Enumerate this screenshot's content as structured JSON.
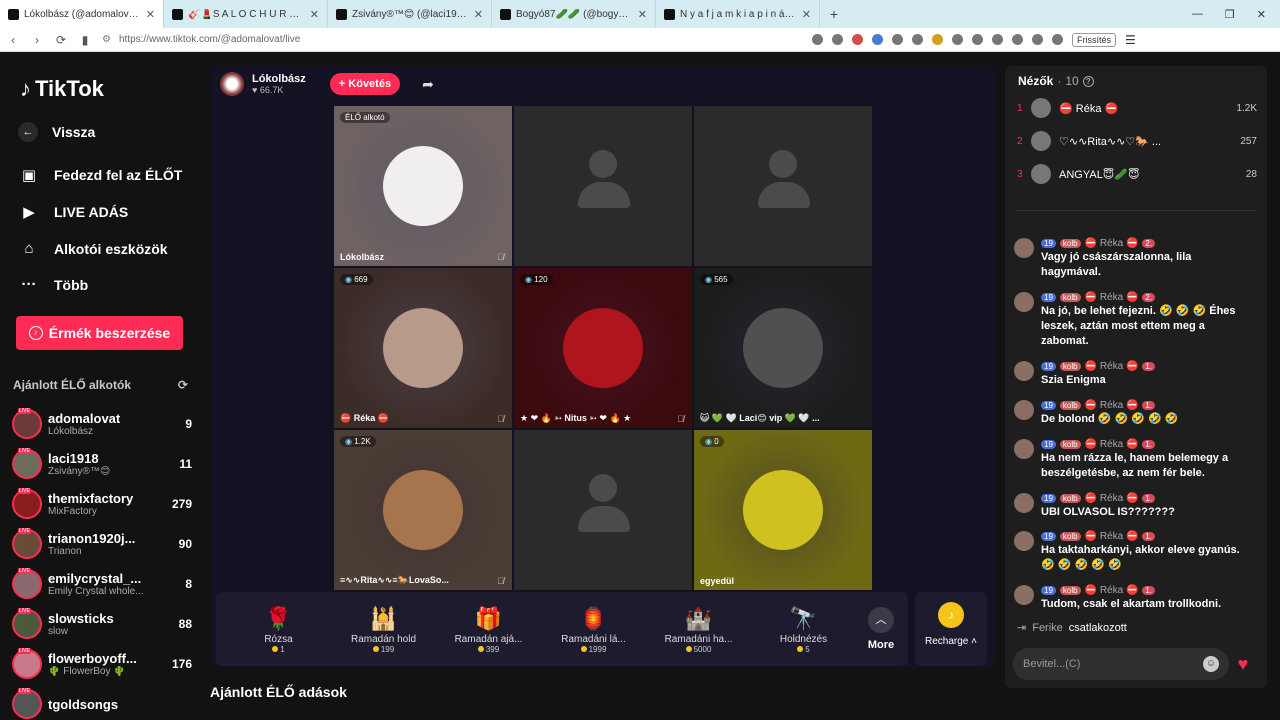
{
  "browser": {
    "tabs": [
      {
        "title": "Lókolbász (@adomalovat) Él…",
        "active": true
      },
      {
        "title": "🎸💄S A L O C H U R 🩸 (@gabor",
        "active": false
      },
      {
        "title": "Zsivány®™😊 (@laci1918) ÉLŐ adás",
        "active": false
      },
      {
        "title": "Bogyó87🥒🥒 (@bogyo87_) ÉLŐ p",
        "active": false
      },
      {
        "title": "N y a f j a m k i a p i n á d f",
        "active": false
      }
    ],
    "url": "https://www.tiktok.com/@adomalovat/live",
    "reload_label": "Frissítés"
  },
  "sidebar": {
    "logo": "TikTok",
    "back": "Vissza",
    "nav": [
      {
        "label": "Fedezd fel az ÉLŐT",
        "icon": "live-explore-icon"
      },
      {
        "label": "LIVE ADÁS",
        "icon": "video-camera-icon"
      },
      {
        "label": "Alkotói eszközök",
        "icon": "home-tools-icon"
      },
      {
        "label": "Több",
        "icon": "more-dots-icon"
      }
    ],
    "coins_button": "Érmék beszerzése",
    "recommended_header": "Ajánlott ÉLŐ alkotók",
    "creators": [
      {
        "name": "adomalovat",
        "sub": "Lókolbász",
        "count": "9",
        "color": "#6b3a3a"
      },
      {
        "name": "laci1918",
        "sub": "Zsivány®™😊",
        "count": "11",
        "color": "#6d6b5a"
      },
      {
        "name": "themixfactory",
        "sub": "MixFactory",
        "count": "279",
        "color": "#8a1d1d"
      },
      {
        "name": "trianon1920j...",
        "sub": "Trianon",
        "count": "90",
        "color": "#6a4b3a"
      },
      {
        "name": "emilycrystal_...",
        "sub": "Emily Crystal whole...",
        "count": "8",
        "color": "#8a6a6e"
      },
      {
        "name": "slowsticks",
        "sub": "slow",
        "count": "88",
        "color": "#4a5a3a"
      },
      {
        "name": "flowerboyoff...",
        "sub": "🌵 FlowerBoy 🌵",
        "count": "176",
        "color": "#c87a8a"
      },
      {
        "name": "tgoldsongs",
        "sub": "",
        "count": "",
        "color": "#555555"
      }
    ]
  },
  "host": {
    "name": "Lókolbász",
    "likes": "66.7K",
    "follow_label": "+ Követés"
  },
  "grid": [
    {
      "badge": "ÉLŐ alkotó",
      "name": "Lókolbász",
      "type": "host",
      "bg": "#6e6262",
      "circle": "#f1eeee"
    },
    {
      "badge": "",
      "name": "",
      "type": "empty"
    },
    {
      "badge": "",
      "name": "",
      "type": "empty"
    },
    {
      "badge": "669",
      "name": "⛔ Réka ⛔",
      "type": "guest",
      "bg": "#3c2c28",
      "circle": "#b89a8a"
    },
    {
      "badge": "120",
      "name": "★ ❤ 🔥 ➳ Nitus ➳ ❤ 🔥 ★",
      "type": "guest",
      "bg": "#3a0a0e",
      "circle": "#b0141c"
    },
    {
      "badge": "565",
      "name": "😺 💚 🤍 Laci😊 vip 💚 🤍 ...",
      "type": "guest",
      "bg": "#1c1c1c",
      "circle": "#505050"
    },
    {
      "badge": "1.2K",
      "name": "≡∿∿Rita∿∿≡🐎LovaSo...",
      "type": "guest",
      "bg": "#4a3e36",
      "circle": "#a6754e"
    },
    {
      "badge": "",
      "name": "",
      "type": "empty"
    },
    {
      "badge": "0",
      "name": "egyedül",
      "type": "guest",
      "bg": "#6e6a14",
      "circle": "#d0c020"
    }
  ],
  "gifts": [
    {
      "name": "Rózsa",
      "price": "1",
      "icon": "rose-icon",
      "glyph": "🌹"
    },
    {
      "name": "Ramadán hold",
      "price": "199",
      "icon": "mosque-moon-icon",
      "glyph": "🕌"
    },
    {
      "name": "Ramadán ajá...",
      "price": "399",
      "icon": "gift-box-icon",
      "glyph": "🎁"
    },
    {
      "name": "Ramadáni lá...",
      "price": "1999",
      "icon": "lantern-icon",
      "glyph": "🏮"
    },
    {
      "name": "Ramadáni ha...",
      "price": "5000",
      "icon": "palace-icon",
      "glyph": "🏰"
    },
    {
      "name": "Holdnézés",
      "price": "5",
      "icon": "telescope-icon",
      "glyph": "🔭"
    }
  ],
  "more_label": "More",
  "recharge_label": "Recharge",
  "recommended_live": "Ajánlott ÉLŐ adások",
  "chat": {
    "viewers_label": "Nézők",
    "viewers_count": "10",
    "ranking": [
      {
        "rank": "1",
        "name": "⛔ Réka ⛔",
        "value": "1.2K"
      },
      {
        "rank": "2",
        "name": "♡∿∿Rita∿∿♡🐎 ...",
        "value": "257"
      },
      {
        "rank": "3",
        "name": "ANGYAL😇🥒😇",
        "value": "28"
      }
    ],
    "messages": [
      {
        "user": "⛔ Réka ⛔",
        "level": "19",
        "fan": "kolb",
        "badge": "2.",
        "text": "Vagy jó császárszalonna, lila hagymával."
      },
      {
        "user": "⛔ Réka ⛔",
        "level": "19",
        "fan": "kolb",
        "badge": "2.",
        "text": "Na jó, be lehet fejezni. 🤣 🤣 🤣 Éhes leszek, aztán most ettem meg a zabomat."
      },
      {
        "user": "⛔ Réka ⛔",
        "level": "19",
        "fan": "kolb",
        "badge": "1.",
        "text": "Szia Enigma"
      },
      {
        "user": "⛔ Réka ⛔",
        "level": "19",
        "fan": "kolb",
        "badge": "1.",
        "text": "De bolond 🤣 🤣 🤣 🤣 🤣"
      },
      {
        "user": "⛔ Réka ⛔",
        "level": "19",
        "fan": "kolb",
        "badge": "1.",
        "text": "Ha nem rázza le, hanem belemegy a beszélgetésbe, az nem fér bele."
      },
      {
        "user": "⛔ Réka ⛔",
        "level": "19",
        "fan": "kolb",
        "badge": "1.",
        "text": "UBI OLVASOL IS???????"
      },
      {
        "user": "⛔ Réka ⛔",
        "level": "19",
        "fan": "kolb",
        "badge": "1.",
        "text": "Ha taktaharkányi, akkor eleve gyanús. 🤣 🤣 🤣 🤣 🤣"
      },
      {
        "user": "⛔ Réka ⛔",
        "level": "19",
        "fan": "kolb",
        "badge": "1.",
        "text": "Tudom, csak el akartam trollkodni."
      }
    ],
    "joined_user": "Ferike",
    "joined_text": "csatlakozott",
    "input_placeholder": "Bevitel...(C)"
  }
}
